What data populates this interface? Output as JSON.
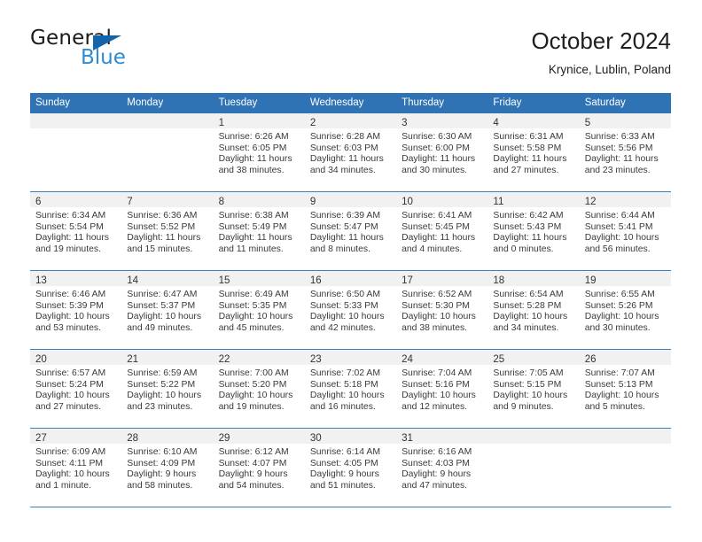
{
  "brand": {
    "word_one": "General",
    "word_two": "Blue",
    "triangle_icon": "triangle-logo-icon",
    "accent_dark": "#1464aa",
    "accent_light": "#2e8bd4"
  },
  "header": {
    "title": "October 2024",
    "location": "Krynice, Lublin, Poland"
  },
  "theme": {
    "header_blue": "#2f73b4",
    "week_separator": "#3b7fbd",
    "daynum_band": "#f1f1f1",
    "text": "#3a3a3a"
  },
  "calendar": {
    "weekday_headers": [
      "Sunday",
      "Monday",
      "Tuesday",
      "Wednesday",
      "Thursday",
      "Friday",
      "Saturday"
    ],
    "labels": {
      "sunrise": "Sunrise:",
      "sunset": "Sunset:",
      "daylight": "Daylight:"
    },
    "weeks": [
      [
        {
          "day": "",
          "lines": []
        },
        {
          "day": "",
          "lines": []
        },
        {
          "day": "1",
          "lines": [
            "Sunrise: 6:26 AM",
            "Sunset: 6:05 PM",
            "Daylight: 11 hours",
            "and 38 minutes."
          ]
        },
        {
          "day": "2",
          "lines": [
            "Sunrise: 6:28 AM",
            "Sunset: 6:03 PM",
            "Daylight: 11 hours",
            "and 34 minutes."
          ]
        },
        {
          "day": "3",
          "lines": [
            "Sunrise: 6:30 AM",
            "Sunset: 6:00 PM",
            "Daylight: 11 hours",
            "and 30 minutes."
          ]
        },
        {
          "day": "4",
          "lines": [
            "Sunrise: 6:31 AM",
            "Sunset: 5:58 PM",
            "Daylight: 11 hours",
            "and 27 minutes."
          ]
        },
        {
          "day": "5",
          "lines": [
            "Sunrise: 6:33 AM",
            "Sunset: 5:56 PM",
            "Daylight: 11 hours",
            "and 23 minutes."
          ]
        }
      ],
      [
        {
          "day": "6",
          "lines": [
            "Sunrise: 6:34 AM",
            "Sunset: 5:54 PM",
            "Daylight: 11 hours",
            "and 19 minutes."
          ]
        },
        {
          "day": "7",
          "lines": [
            "Sunrise: 6:36 AM",
            "Sunset: 5:52 PM",
            "Daylight: 11 hours",
            "and 15 minutes."
          ]
        },
        {
          "day": "8",
          "lines": [
            "Sunrise: 6:38 AM",
            "Sunset: 5:49 PM",
            "Daylight: 11 hours",
            "and 11 minutes."
          ]
        },
        {
          "day": "9",
          "lines": [
            "Sunrise: 6:39 AM",
            "Sunset: 5:47 PM",
            "Daylight: 11 hours",
            "and 8 minutes."
          ]
        },
        {
          "day": "10",
          "lines": [
            "Sunrise: 6:41 AM",
            "Sunset: 5:45 PM",
            "Daylight: 11 hours",
            "and 4 minutes."
          ]
        },
        {
          "day": "11",
          "lines": [
            "Sunrise: 6:42 AM",
            "Sunset: 5:43 PM",
            "Daylight: 11 hours",
            "and 0 minutes."
          ]
        },
        {
          "day": "12",
          "lines": [
            "Sunrise: 6:44 AM",
            "Sunset: 5:41 PM",
            "Daylight: 10 hours",
            "and 56 minutes."
          ]
        }
      ],
      [
        {
          "day": "13",
          "lines": [
            "Sunrise: 6:46 AM",
            "Sunset: 5:39 PM",
            "Daylight: 10 hours",
            "and 53 minutes."
          ]
        },
        {
          "day": "14",
          "lines": [
            "Sunrise: 6:47 AM",
            "Sunset: 5:37 PM",
            "Daylight: 10 hours",
            "and 49 minutes."
          ]
        },
        {
          "day": "15",
          "lines": [
            "Sunrise: 6:49 AM",
            "Sunset: 5:35 PM",
            "Daylight: 10 hours",
            "and 45 minutes."
          ]
        },
        {
          "day": "16",
          "lines": [
            "Sunrise: 6:50 AM",
            "Sunset: 5:33 PM",
            "Daylight: 10 hours",
            "and 42 minutes."
          ]
        },
        {
          "day": "17",
          "lines": [
            "Sunrise: 6:52 AM",
            "Sunset: 5:30 PM",
            "Daylight: 10 hours",
            "and 38 minutes."
          ]
        },
        {
          "day": "18",
          "lines": [
            "Sunrise: 6:54 AM",
            "Sunset: 5:28 PM",
            "Daylight: 10 hours",
            "and 34 minutes."
          ]
        },
        {
          "day": "19",
          "lines": [
            "Sunrise: 6:55 AM",
            "Sunset: 5:26 PM",
            "Daylight: 10 hours",
            "and 30 minutes."
          ]
        }
      ],
      [
        {
          "day": "20",
          "lines": [
            "Sunrise: 6:57 AM",
            "Sunset: 5:24 PM",
            "Daylight: 10 hours",
            "and 27 minutes."
          ]
        },
        {
          "day": "21",
          "lines": [
            "Sunrise: 6:59 AM",
            "Sunset: 5:22 PM",
            "Daylight: 10 hours",
            "and 23 minutes."
          ]
        },
        {
          "day": "22",
          "lines": [
            "Sunrise: 7:00 AM",
            "Sunset: 5:20 PM",
            "Daylight: 10 hours",
            "and 19 minutes."
          ]
        },
        {
          "day": "23",
          "lines": [
            "Sunrise: 7:02 AM",
            "Sunset: 5:18 PM",
            "Daylight: 10 hours",
            "and 16 minutes."
          ]
        },
        {
          "day": "24",
          "lines": [
            "Sunrise: 7:04 AM",
            "Sunset: 5:16 PM",
            "Daylight: 10 hours",
            "and 12 minutes."
          ]
        },
        {
          "day": "25",
          "lines": [
            "Sunrise: 7:05 AM",
            "Sunset: 5:15 PM",
            "Daylight: 10 hours",
            "and 9 minutes."
          ]
        },
        {
          "day": "26",
          "lines": [
            "Sunrise: 7:07 AM",
            "Sunset: 5:13 PM",
            "Daylight: 10 hours",
            "and 5 minutes."
          ]
        }
      ],
      [
        {
          "day": "27",
          "lines": [
            "Sunrise: 6:09 AM",
            "Sunset: 4:11 PM",
            "Daylight: 10 hours",
            "and 1 minute."
          ]
        },
        {
          "day": "28",
          "lines": [
            "Sunrise: 6:10 AM",
            "Sunset: 4:09 PM",
            "Daylight: 9 hours",
            "and 58 minutes."
          ]
        },
        {
          "day": "29",
          "lines": [
            "Sunrise: 6:12 AM",
            "Sunset: 4:07 PM",
            "Daylight: 9 hours",
            "and 54 minutes."
          ]
        },
        {
          "day": "30",
          "lines": [
            "Sunrise: 6:14 AM",
            "Sunset: 4:05 PM",
            "Daylight: 9 hours",
            "and 51 minutes."
          ]
        },
        {
          "day": "31",
          "lines": [
            "Sunrise: 6:16 AM",
            "Sunset: 4:03 PM",
            "Daylight: 9 hours",
            "and 47 minutes."
          ]
        },
        {
          "day": "",
          "lines": []
        },
        {
          "day": "",
          "lines": []
        }
      ]
    ]
  }
}
